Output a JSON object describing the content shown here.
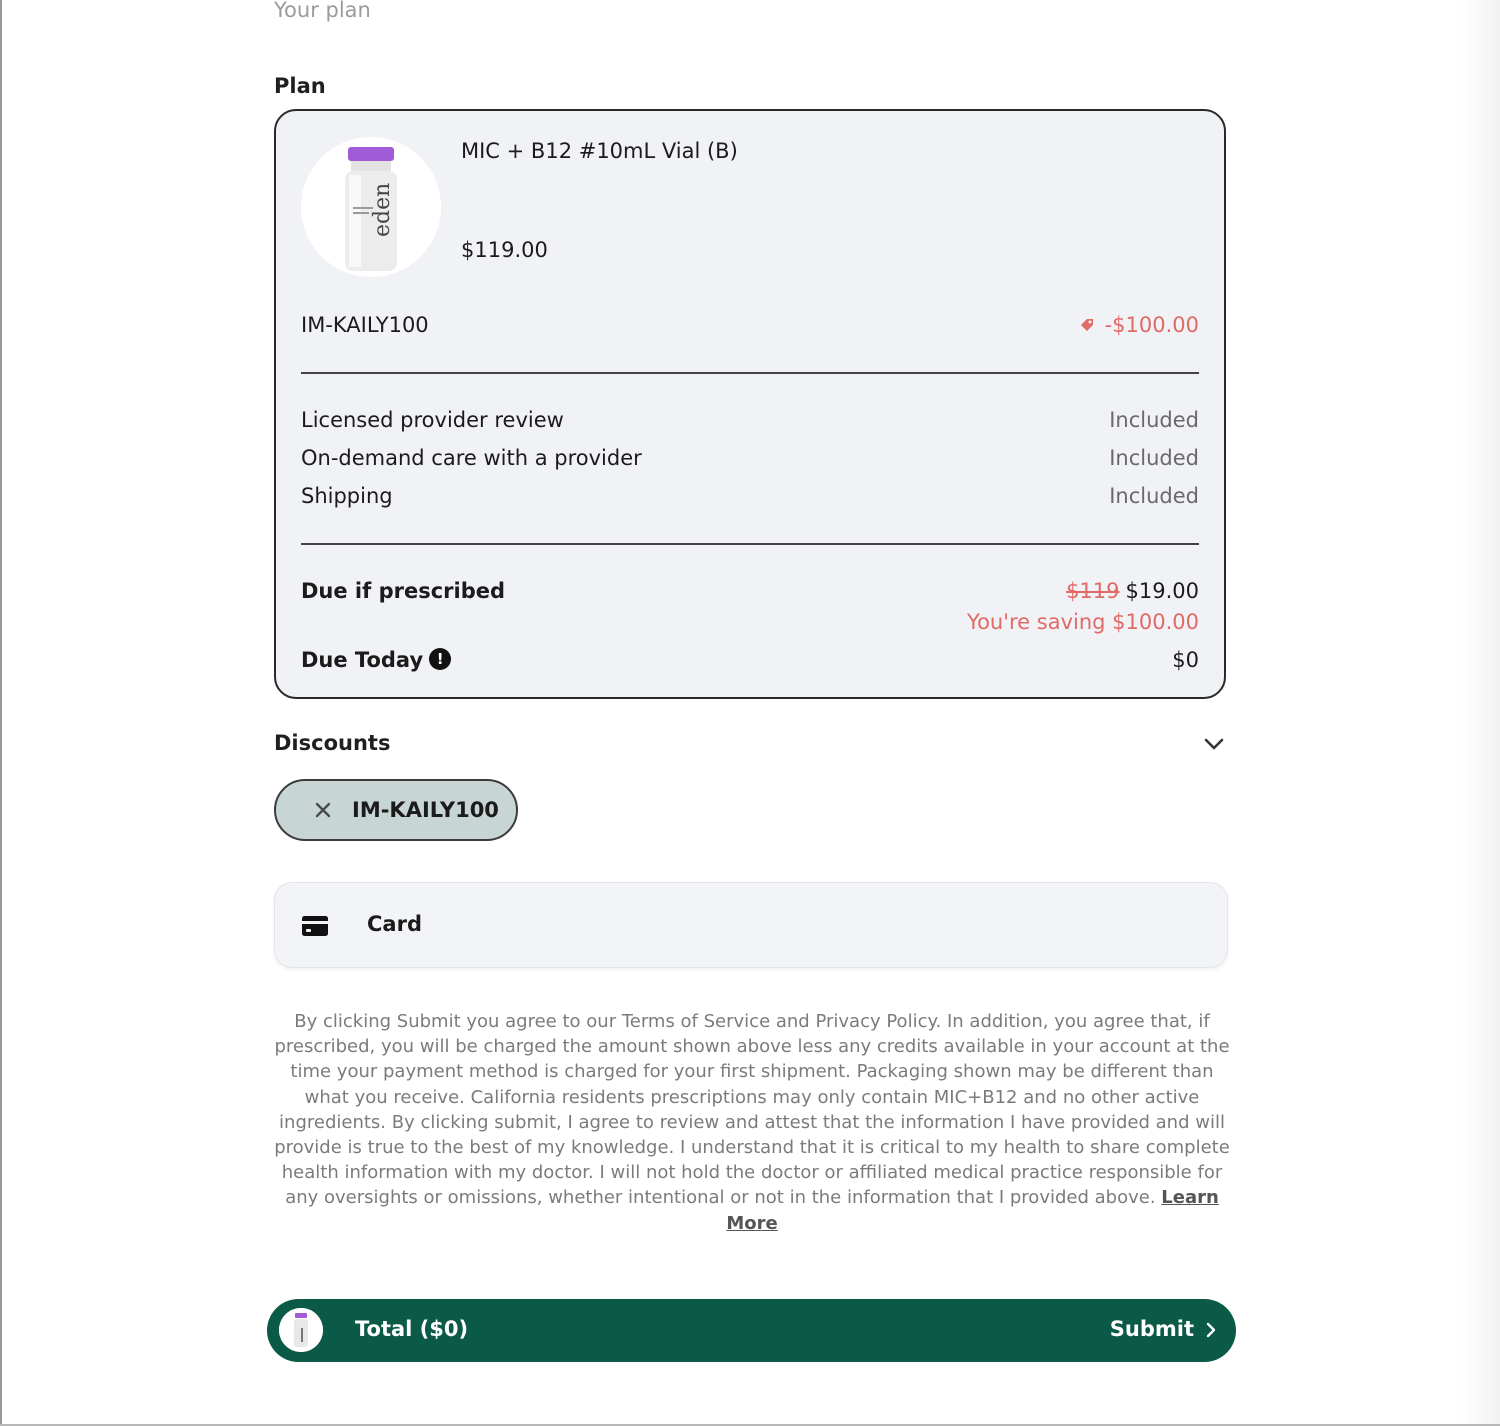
{
  "header": {
    "your_plan": "Your plan",
    "plan_heading": "Plan"
  },
  "product": {
    "name": "MIC + B12 #10mL Vial (B)",
    "price": "$119.00",
    "image_icon": "vial-image",
    "vial_brand": "eden"
  },
  "promo": {
    "code": "IM-KAILY100",
    "discount": "-$100.00"
  },
  "features": [
    {
      "label": "Licensed provider review",
      "value": "Included"
    },
    {
      "label": "On-demand care with a provider",
      "value": "Included"
    },
    {
      "label": "Shipping",
      "value": "Included"
    }
  ],
  "due_if_prescribed": {
    "label": "Due if prescribed",
    "original": "$119",
    "amount": "$19.00",
    "saving": "You're saving $100.00"
  },
  "due_today": {
    "label": "Due Today",
    "info_icon": "!",
    "amount": "$0"
  },
  "discounts": {
    "heading": "Discounts",
    "applied_code": "IM-KAILY100"
  },
  "payment": {
    "method_label": "Card",
    "icon": "credit-card-icon"
  },
  "legal": {
    "text": "By clicking Submit you agree to our Terms of Service and Privacy Policy. In addition, you agree that, if prescribed, you will be charged the amount shown above less any credits available in your account at the time your payment method is charged for your first shipment. Packaging shown may be different than what you receive. California residents prescriptions may only contain MIC+B12 and no other active ingredients. By clicking submit, I agree to review and attest that the information I have provided and will provide is true to the best of my knowledge. I understand that it is critical to my health to share complete health information with my doctor. I will not hold the doctor or affiliated medical practice responsible for any oversights or omissions, whether intentional or not in the information that I provided above.",
    "learn_more": "Learn More"
  },
  "footer": {
    "total_label": "Total ($0)",
    "submit_label": "Submit"
  },
  "colors": {
    "accent_green": "#0b5a47",
    "discount_red": "#e06a66",
    "card_bg": "#f1f2f6",
    "chip_bg": "#c7d6d4"
  }
}
